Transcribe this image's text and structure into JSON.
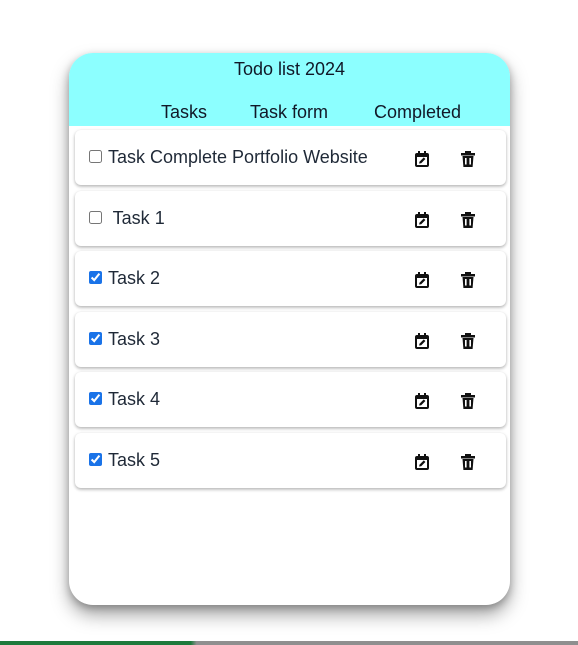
{
  "app": {
    "title": "Todo list 2024"
  },
  "nav": {
    "tasks": "Tasks",
    "task_form": "Task form",
    "completed": "Completed"
  },
  "tasks": [
    {
      "label": "Task Complete Portfolio Website",
      "checked": false
    },
    {
      "label": " Task 1",
      "checked": false
    },
    {
      "label": "Task 2",
      "checked": true
    },
    {
      "label": "Task 3",
      "checked": true
    },
    {
      "label": "Task 4",
      "checked": true
    },
    {
      "label": "Task 5",
      "checked": true
    }
  ],
  "icons": {
    "edit": "calendar-edit-icon",
    "delete": "trash-icon"
  },
  "colors": {
    "header_bg": "#8cffff",
    "checkbox_accent": "#1a73e8"
  }
}
